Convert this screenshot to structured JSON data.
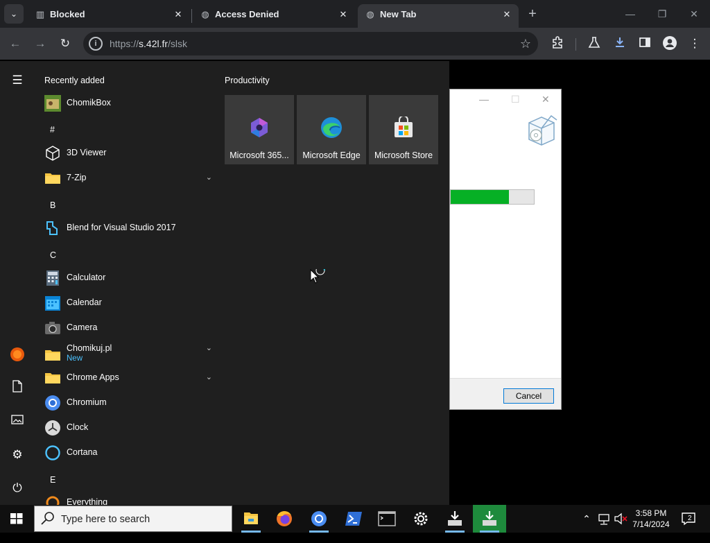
{
  "browser": {
    "tabs": [
      {
        "title": "Blocked",
        "close": "✕"
      },
      {
        "title": "Access Denied",
        "close": "✕"
      },
      {
        "title": "New Tab",
        "close": "✕"
      }
    ],
    "new_tab_glyph": "+",
    "url_prefix": "https://",
    "url_host": "s.42l.fr",
    "url_path": "/slsk",
    "window_controls": {
      "minimize": "—",
      "restore": "❐",
      "close": "✕"
    }
  },
  "installer": {
    "progress_fraction": 0.7,
    "cancel_label": "Cancel"
  },
  "start_menu": {
    "recently_added_heading": "Recently added",
    "apps": [
      {
        "kind": "app",
        "label": "ChomikBox",
        "icon": "chomikbox-icon"
      },
      {
        "kind": "letter",
        "label": "#"
      },
      {
        "kind": "app",
        "label": "3D Viewer",
        "icon": "cube-icon"
      },
      {
        "kind": "app",
        "label": "7-Zip",
        "icon": "folder-icon",
        "expandable": true
      },
      {
        "kind": "letter",
        "label": "B"
      },
      {
        "kind": "app",
        "label": "Blend for Visual Studio 2017",
        "icon": "blend-icon"
      },
      {
        "kind": "letter",
        "label": "C"
      },
      {
        "kind": "app",
        "label": "Calculator",
        "icon": "calculator-icon"
      },
      {
        "kind": "app",
        "label": "Calendar",
        "icon": "calendar-icon"
      },
      {
        "kind": "app",
        "label": "Camera",
        "icon": "camera-icon"
      },
      {
        "kind": "app",
        "label": "Chomikuj.pl",
        "sub": "New",
        "icon": "folder-icon",
        "expandable": true
      },
      {
        "kind": "app",
        "label": "Chrome Apps",
        "icon": "folder-icon",
        "expandable": true
      },
      {
        "kind": "app",
        "label": "Chromium",
        "icon": "chromium-icon"
      },
      {
        "kind": "app",
        "label": "Clock",
        "icon": "clock-icon"
      },
      {
        "kind": "app",
        "label": "Cortana",
        "icon": "cortana-icon"
      },
      {
        "kind": "letter",
        "label": "E"
      },
      {
        "kind": "app",
        "label": "Everything",
        "icon": "everything-icon"
      }
    ],
    "productivity_heading": "Productivity",
    "tiles": [
      {
        "label": "Microsoft 365...",
        "icon": "microsoft-365-icon"
      },
      {
        "label": "Microsoft Edge",
        "icon": "edge-icon"
      },
      {
        "label": "Microsoft Store",
        "icon": "store-icon"
      }
    ]
  },
  "taskbar": {
    "search_placeholder": "Type here to search",
    "time": "3:58 PM",
    "date": "7/14/2024",
    "notification_count": "2"
  }
}
